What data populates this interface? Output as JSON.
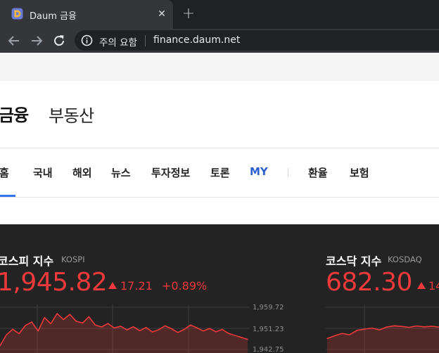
{
  "browser": {
    "tab": {
      "title": "Daum 금융"
    },
    "omnibox": {
      "security_label": "주의 요함",
      "url": "finance.daum.net"
    },
    "icons": [
      "daum-favicon",
      "close-icon",
      "plus-icon",
      "back-arrow-icon",
      "forward-arrow-icon",
      "reload-icon",
      "info-icon"
    ]
  },
  "header": {
    "service_title": "금융",
    "service_alt": "부동산"
  },
  "gnb": {
    "items": [
      {
        "label": "홈"
      },
      {
        "label": "국내"
      },
      {
        "label": "해외"
      },
      {
        "label": "뉴스"
      },
      {
        "label": "투자정보"
      },
      {
        "label": "토론"
      },
      {
        "label": "MY"
      },
      {
        "label": "환율"
      },
      {
        "label": "보험"
      }
    ],
    "active_index": 0
  },
  "market": {
    "kospi": {
      "name": "코스피 지수",
      "name_en": "KOSPI",
      "value": "1,945.82",
      "change": "17.21",
      "change_pct": "+0.89%",
      "direction": "up"
    },
    "kosdaq": {
      "name": "코스닥 지수",
      "name_en": "KOSDAQ",
      "value": "682.30",
      "change": "14"
    },
    "axis": {
      "labels": [
        "1,959.72",
        "1,951.23",
        "1,942.75"
      ]
    }
  },
  "colors": {
    "up": "#f0393b",
    "panel_bg": "#232323",
    "active_tab": "#3374f0",
    "my_link": "#2c5fd1"
  },
  "chart_data": [
    {
      "type": "area",
      "title": "코스피 지수",
      "ylim": [
        1942.75,
        1959.72
      ],
      "y_ticks": [
        "1,959.72",
        "1,951.23",
        "1,942.75"
      ],
      "values": [
        1944.2,
        1948.6,
        1950.9,
        1949.1,
        1952.4,
        1953.8,
        1950.2,
        1955.6,
        1953.1,
        1957.2,
        1954.8,
        1956.9,
        1954.1,
        1953.4,
        1955.9,
        1952.6,
        1951.8,
        1953.2,
        1951.4,
        1952.1,
        1950.6,
        1951.9,
        1950.3,
        1951.6,
        1949.8,
        1950.7,
        1952.3,
        1951.1,
        1949.6,
        1950.8,
        1952.6,
        1951.5,
        1950.2,
        1951.2,
        1949.9,
        1950.8,
        1949.2,
        1948.4,
        1947.6,
        1946.8
      ]
    },
    {
      "type": "area",
      "title": "코스닥 지수",
      "values": [
        674.2,
        675.8,
        677.1,
        676.4,
        678.9,
        679.6,
        680.2,
        679.1,
        680.8,
        681.5,
        681.1,
        680.6,
        681.4,
        680.9,
        681.2,
        680.8
      ]
    }
  ]
}
